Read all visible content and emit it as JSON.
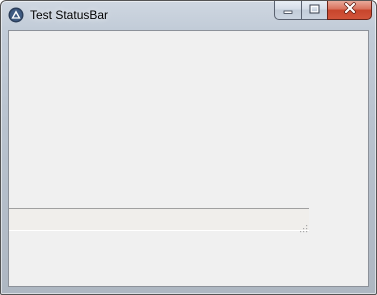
{
  "window": {
    "title": "Test StatusBar",
    "icon": "app-logo-icon"
  },
  "caption_buttons": [
    {
      "name": "minimize",
      "icon": "minimize-icon"
    },
    {
      "name": "maximize",
      "icon": "maximize-icon"
    },
    {
      "name": "close",
      "icon": "close-icon"
    }
  ],
  "statusbar": {
    "text": "",
    "grip_icon": "size-grip-icon"
  },
  "colors": {
    "frame": "#c2ccd8",
    "client_background": "#f0f0f0",
    "statusbar_background": "#f0eeeb",
    "close_button": "#c7452c"
  }
}
